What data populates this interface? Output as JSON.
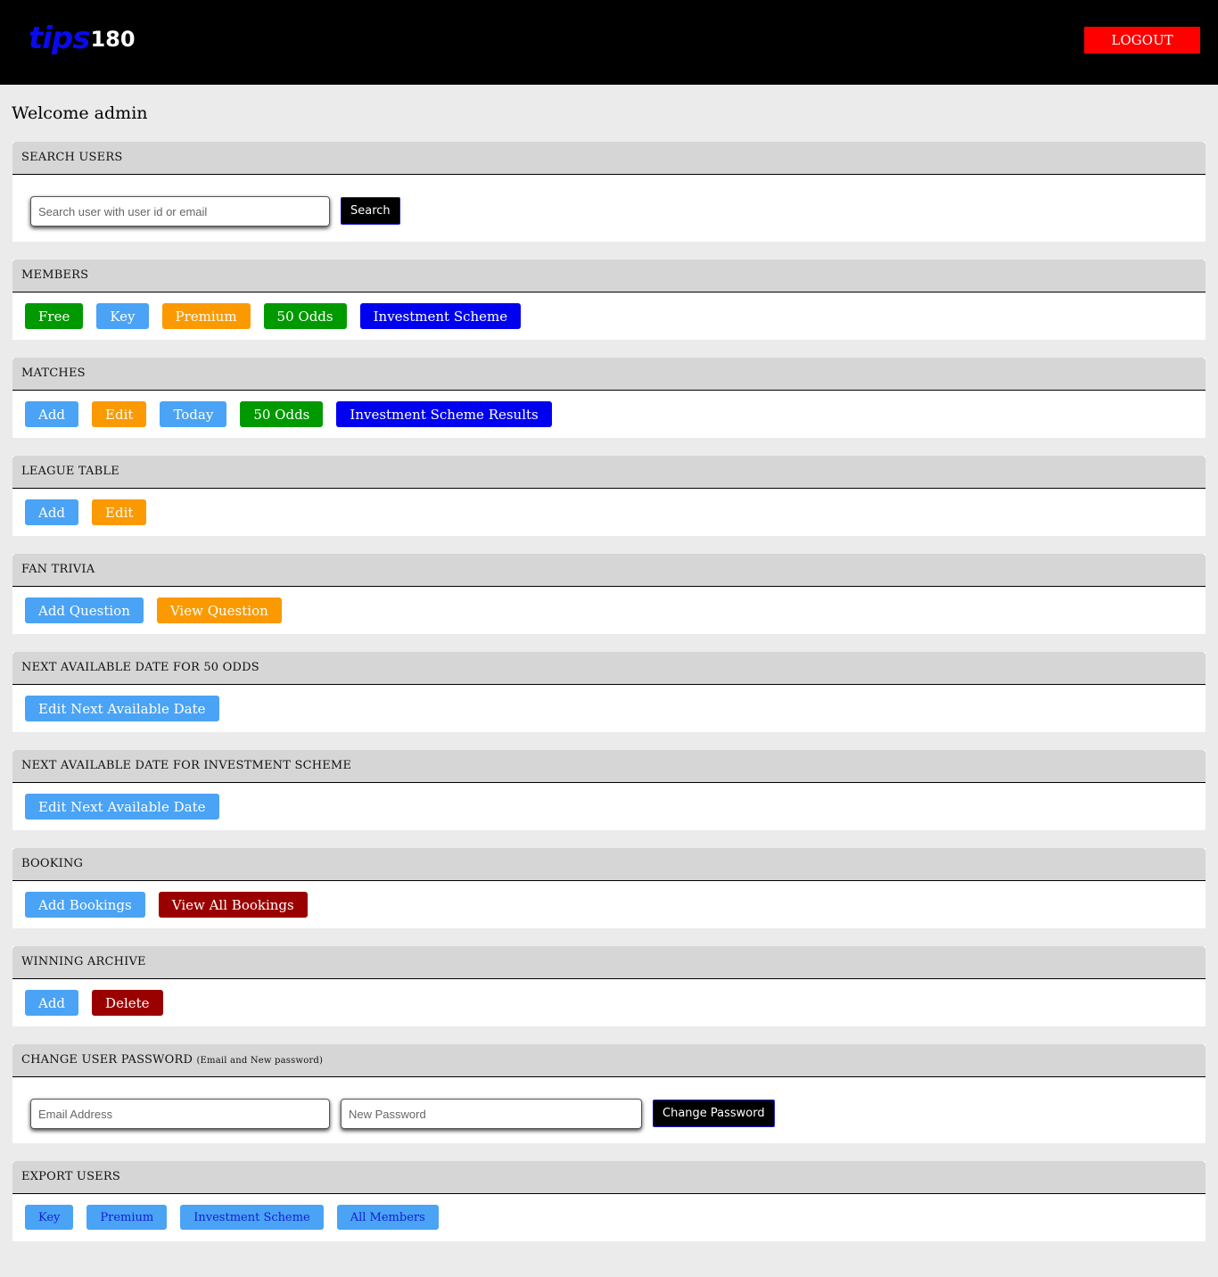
{
  "header": {
    "logo_text": "tips",
    "logo_number": "180",
    "logout_label": "LOGOUT"
  },
  "welcome": "Welcome admin",
  "search_users": {
    "title": "SEARCH USERS",
    "placeholder": "Search user with user id or email",
    "button": "Search"
  },
  "members": {
    "title": "MEMBERS",
    "buttons": [
      "Free",
      "Key",
      "Premium",
      "50 Odds",
      "Investment Scheme"
    ]
  },
  "matches": {
    "title": "MATCHES",
    "buttons": [
      "Add",
      "Edit",
      "Today",
      "50 Odds",
      "Investment Scheme Results"
    ]
  },
  "league_table": {
    "title": "LEAGUE TABLE",
    "buttons": [
      "Add",
      "Edit"
    ]
  },
  "fan_trivia": {
    "title": "FAN TRIVIA",
    "buttons": [
      "Add Question",
      "View Question"
    ]
  },
  "next_date_50": {
    "title": "NEXT AVAILABLE DATE FOR 50 ODDS",
    "button": "Edit Next Available Date"
  },
  "next_date_investment": {
    "title": "NEXT AVAILABLE DATE FOR INVESTMENT SCHEME",
    "button": "Edit Next Available Date"
  },
  "booking": {
    "title": "BOOKING",
    "buttons": [
      "Add Bookings",
      "View All Bookings"
    ]
  },
  "winning_archive": {
    "title": "WINNING ARCHIVE",
    "buttons": [
      "Add",
      "Delete"
    ]
  },
  "change_password": {
    "title": "CHANGE USER PASSWORD",
    "subtitle": "(Email and New password)",
    "email_placeholder": "Email Address",
    "password_placeholder": "New Password",
    "button": "Change Password"
  },
  "export_users": {
    "title": "EXPORT USERS",
    "buttons": [
      "Key",
      "Premium",
      "Investment Scheme",
      "All Members"
    ]
  },
  "colors": {
    "header_bg": "#000000",
    "logout_bg": "#ff0000",
    "logo_blue": "#0a0af0",
    "green": "#009a00",
    "light_blue": "#4aa3f5",
    "orange": "#fb9a00",
    "navy": "#0000f0",
    "maroon": "#9b0000"
  }
}
